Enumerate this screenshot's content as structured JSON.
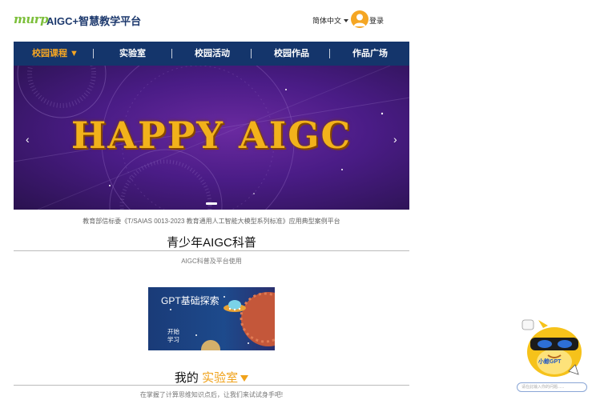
{
  "header": {
    "logo_text": "murp",
    "title": "AIGC+智慧教学平台",
    "language": "简体中文",
    "login": "登录"
  },
  "nav": {
    "items": [
      {
        "label": "校园课程 ▼",
        "active": true
      },
      {
        "label": "实验室",
        "active": false
      },
      {
        "label": "校园活动",
        "active": false
      },
      {
        "label": "校园作品",
        "active": false
      },
      {
        "label": "作品广场",
        "active": false
      }
    ]
  },
  "banner": {
    "title": "HAPPY AIGC",
    "prev_arrow": "‹",
    "next_arrow": "›"
  },
  "subline": "教育部信标委《T/SAIAS 0013-2023 教育通用人工智能大模型系列标准》应用典型案例平台",
  "section1": {
    "title": "青少年AIGC科普",
    "subtitle": "AIGC科普及平台使用"
  },
  "course_card": {
    "title": "GPT基础探索",
    "start": "开始学习"
  },
  "section2": {
    "title_prefix": "我的",
    "title_accent": "实验室",
    "subtitle": "在掌握了计算思维知识点后，让我们来试试身手吧!"
  },
  "assistant": {
    "name": "小鲸GPT",
    "placeholder": "请在此输入你的问题......"
  },
  "colors": {
    "nav_bg": "#14356b",
    "accent": "#f5a623",
    "banner_purple": "#4a1c86"
  }
}
